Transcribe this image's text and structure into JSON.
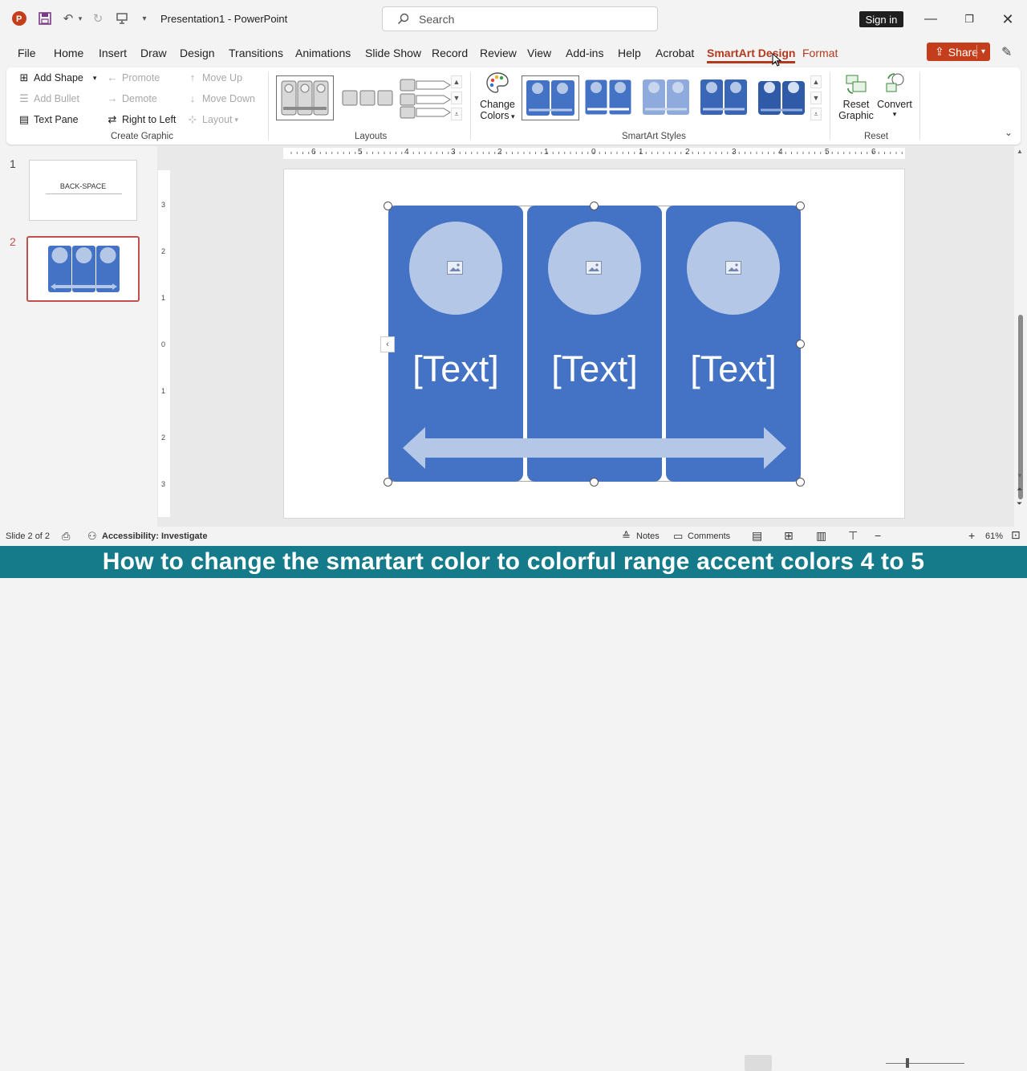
{
  "app": {
    "title": "Presentation1",
    "app_name": "PowerPoint",
    "separator": " - "
  },
  "search": {
    "placeholder": "Search"
  },
  "account": {
    "signin_label": "Sign in"
  },
  "tabs": [
    "File",
    "Home",
    "Insert",
    "Draw",
    "Design",
    "Transitions",
    "Animations",
    "Slide Show",
    "Record",
    "Review",
    "View",
    "Add-ins",
    "Help",
    "Acrobat",
    "SmartArt Design",
    "Format"
  ],
  "active_tab": "SmartArt Design",
  "share": {
    "label": "Share"
  },
  "ribbon": {
    "create_graphic": {
      "label": "Create Graphic",
      "add_shape": "Add Shape",
      "add_bullet": "Add Bullet",
      "text_pane": "Text Pane",
      "promote": "Promote",
      "demote": "Demote",
      "right_to_left": "Right to Left",
      "move_up": "Move Up",
      "move_down": "Move Down",
      "layout": "Layout"
    },
    "layouts": {
      "label": "Layouts"
    },
    "smartart_styles": {
      "label": "SmartArt Styles",
      "change_colors_1": "Change",
      "change_colors_2": "Colors"
    },
    "reset": {
      "label": "Reset",
      "reset_graphic_1": "Reset",
      "reset_graphic_2": "Graphic",
      "convert": "Convert"
    }
  },
  "slides": {
    "items": [
      {
        "number": "1",
        "title": "BACK-SPACE"
      },
      {
        "number": "2"
      }
    ]
  },
  "smartart": {
    "items": [
      {
        "text": "[Text]"
      },
      {
        "text": "[Text]"
      },
      {
        "text": "[Text]"
      }
    ]
  },
  "ruler": {
    "h_ticks": [
      "6",
      "5",
      "4",
      "3",
      "2",
      "1",
      "0",
      "1",
      "2",
      "3",
      "4",
      "5",
      "6"
    ],
    "v_ticks": [
      "3",
      "2",
      "1",
      "0",
      "1",
      "2",
      "3"
    ]
  },
  "status": {
    "slide_info": "Slide 2 of 2",
    "accessibility": "Accessibility: Investigate",
    "notes": "Notes",
    "comments": "Comments",
    "zoom": "61%"
  },
  "banner": {
    "text": "How to change the smartart color to colorful range accent colors 4 to 5"
  },
  "colors": {
    "accent": "#b33a1d",
    "smartart_fill": "#4472c4",
    "smartart_light": "#b4c7e7",
    "banner": "#157a8a",
    "share": "#c43e1c"
  }
}
